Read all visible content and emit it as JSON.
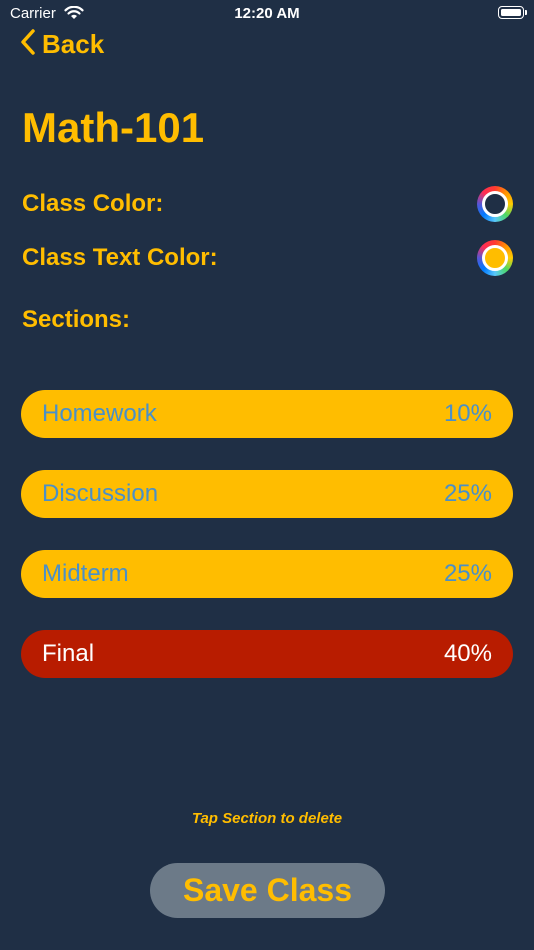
{
  "status_bar": {
    "carrier": "Carrier",
    "time": "12:20 AM"
  },
  "nav": {
    "back_label": "Back"
  },
  "page": {
    "title": "Math-101"
  },
  "settings": {
    "class_color_label": "Class Color:",
    "class_color_value": "#1f2f45",
    "class_text_color_label": "Class Text Color:",
    "class_text_color_value": "#ffbd00"
  },
  "sections_label": "Sections:",
  "sections": [
    {
      "name": "Homework",
      "percent": "10%",
      "background": "#ffbd00",
      "text_color": "#4a90c8"
    },
    {
      "name": "Discussion",
      "percent": "25%",
      "background": "#ffbd00",
      "text_color": "#4a90c8"
    },
    {
      "name": "Midterm",
      "percent": "25%",
      "background": "#ffbd00",
      "text_color": "#4a90c8"
    },
    {
      "name": "Final",
      "percent": "40%",
      "background": "#b81c00",
      "text_color": "#ffffff"
    }
  ],
  "hint": "Tap Section to delete",
  "save_button_label": "Save Class",
  "colors": {
    "background": "#1f2f45",
    "accent": "#ffbd00",
    "button_gray": "#6c7a88"
  }
}
